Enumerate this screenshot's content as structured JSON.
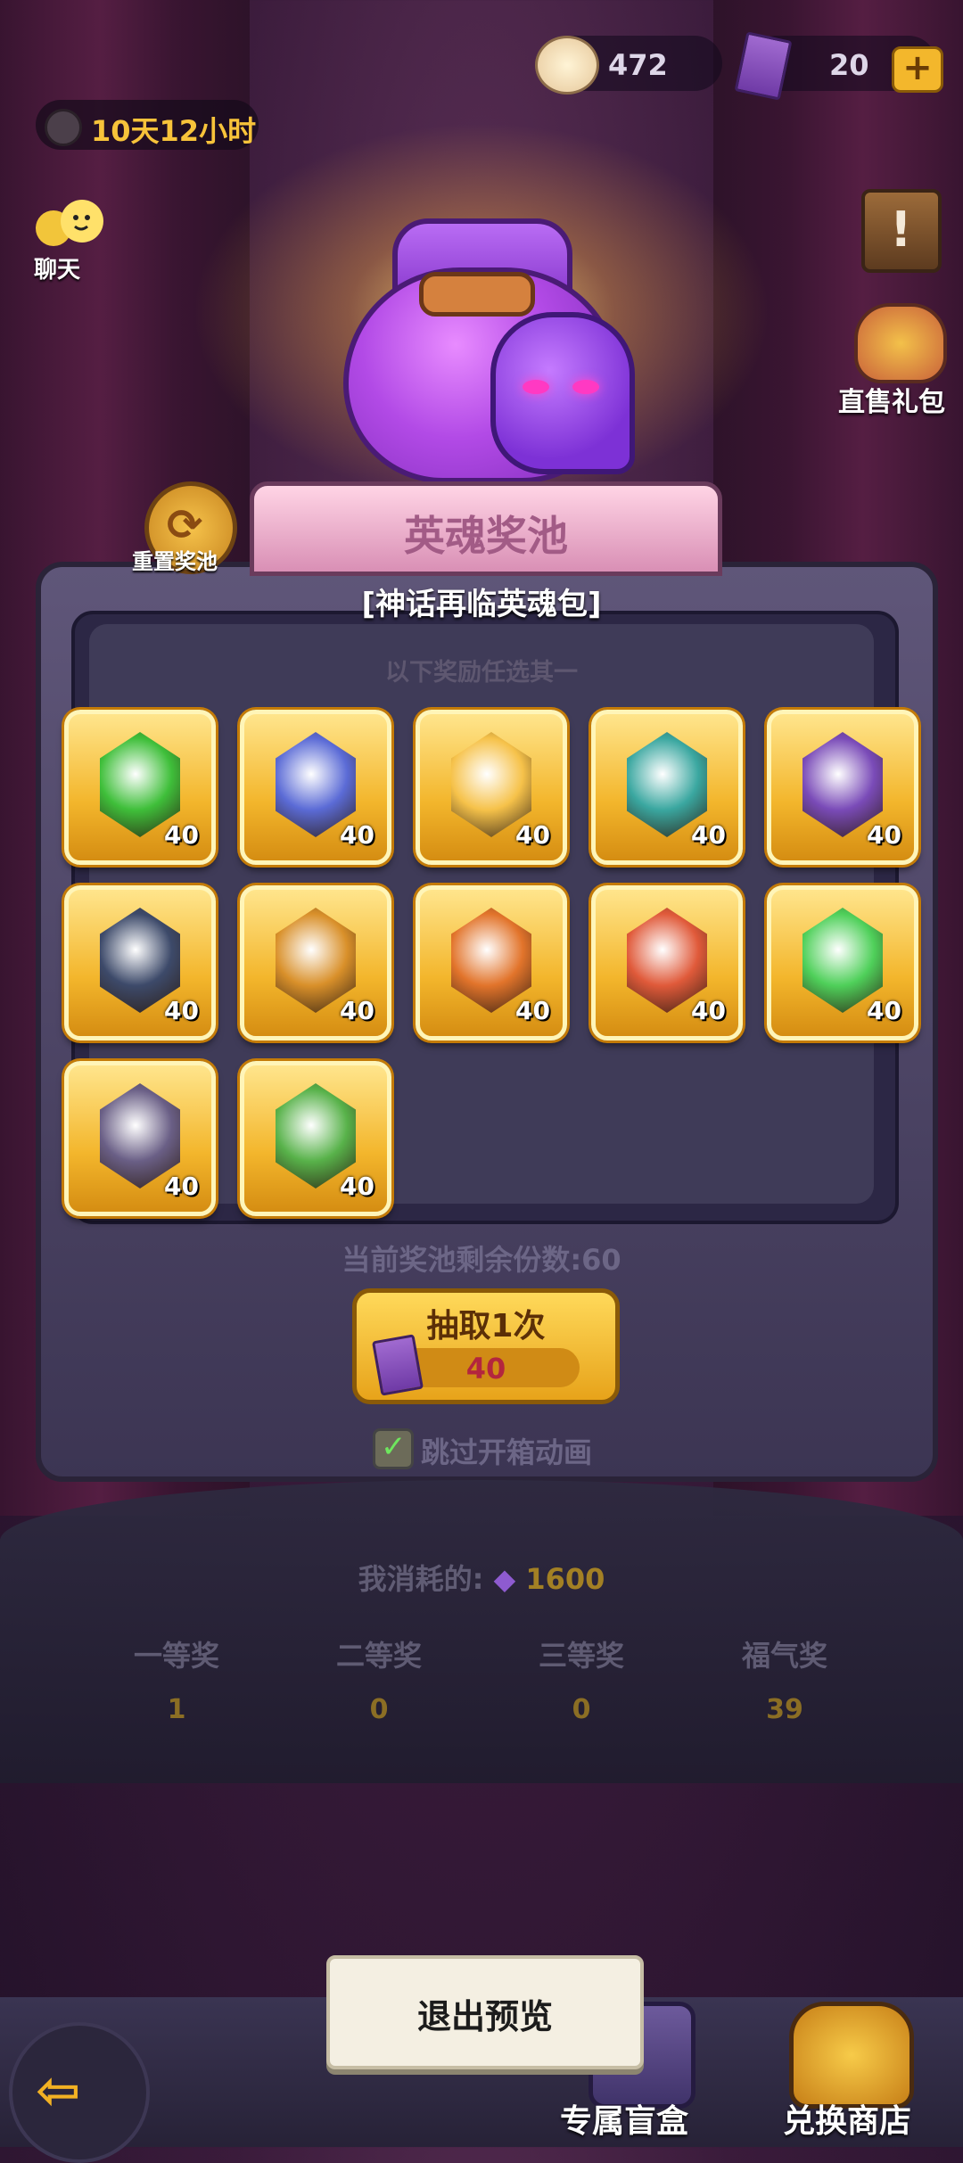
{
  "top_bar": {
    "shells": "472",
    "tickets": "20",
    "timer": "10天12小时"
  },
  "left_side": {
    "chat_label": "聊天",
    "reset_label": "重置奖池"
  },
  "right_side": {
    "gift_label": "直售礼包"
  },
  "pool": {
    "title": "英魂奖池"
  },
  "popup": {
    "title": "[神话再临英魂包]",
    "subtitle": "以下奖励任选其一",
    "rewards": [
      {
        "count": "40",
        "color": "#3fbf3a"
      },
      {
        "count": "40",
        "color": "#5b6bd6"
      },
      {
        "count": "40",
        "color": "#f6c24a"
      },
      {
        "count": "40",
        "color": "#3aa7a0"
      },
      {
        "count": "40",
        "color": "#7a4bb8"
      },
      {
        "count": "40",
        "color": "#3d4a6a"
      },
      {
        "count": "40",
        "color": "#d9902a"
      },
      {
        "count": "40",
        "color": "#e2742b"
      },
      {
        "count": "40",
        "color": "#e05a3a"
      },
      {
        "count": "40",
        "color": "#4fd05a"
      },
      {
        "count": "40",
        "color": "#6a5f86"
      },
      {
        "count": "40",
        "color": "#58b24a"
      }
    ]
  },
  "draw": {
    "remaining": "当前奖池剩余份数:60",
    "button_label": "抽取1次",
    "cost": "40",
    "skip_label": "跳过开箱动画"
  },
  "stats": {
    "consumed_label": "我消耗的:",
    "consumed_value": "1600",
    "items": [
      {
        "title": "一等奖",
        "value": "1"
      },
      {
        "title": "二等奖",
        "value": "0"
      },
      {
        "title": "三等奖",
        "value": "0"
      },
      {
        "title": "福气奖",
        "value": "39"
      }
    ]
  },
  "bottom": {
    "exit_label": "退出预览",
    "box_label": "专属盲盒",
    "shop_label": "兑换商店"
  }
}
